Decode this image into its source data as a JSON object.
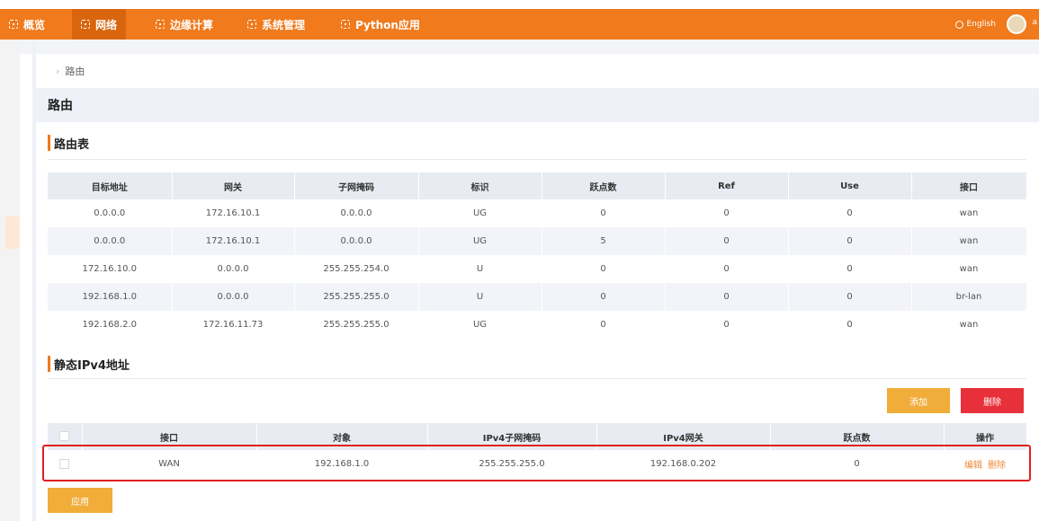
{
  "topnav": {
    "items": [
      {
        "label": "概览"
      },
      {
        "label": "网络"
      },
      {
        "label": "边缘计算"
      },
      {
        "label": "系统管理"
      },
      {
        "label": "Python应用"
      }
    ],
    "active_index": 1,
    "language": "English",
    "user_initial": "a"
  },
  "breadcrumb": {
    "current": "路由"
  },
  "page_title": "路由",
  "route_table": {
    "title": "路由表",
    "columns": [
      "目标地址",
      "网关",
      "子网掩码",
      "标识",
      "跃点数",
      "Ref",
      "Use",
      "接口"
    ],
    "rows": [
      [
        "0.0.0.0",
        "172.16.10.1",
        "0.0.0.0",
        "UG",
        "0",
        "0",
        "0",
        "wan"
      ],
      [
        "0.0.0.0",
        "172.16.10.1",
        "0.0.0.0",
        "UG",
        "5",
        "0",
        "0",
        "wan"
      ],
      [
        "172.16.10.0",
        "0.0.0.0",
        "255.255.254.0",
        "U",
        "0",
        "0",
        "0",
        "wan"
      ],
      [
        "192.168.1.0",
        "0.0.0.0",
        "255.255.255.0",
        "U",
        "0",
        "0",
        "0",
        "br-lan"
      ],
      [
        "192.168.2.0",
        "172.16.11.73",
        "255.255.255.0",
        "UG",
        "0",
        "0",
        "0",
        "wan"
      ]
    ]
  },
  "static_ipv4": {
    "title": "静态IPv4地址",
    "add_label": "添加",
    "delete_label": "删除",
    "columns": [
      "接口",
      "对象",
      "IPv4子网掩码",
      "IPv4网关",
      "跃点数",
      "操作"
    ],
    "rows": [
      {
        "interface": "WAN",
        "object": "192.168.1.0",
        "mask": "255.255.255.0",
        "gateway": "192.168.0.202",
        "metric": "0",
        "edit": "编辑",
        "delete": "删除"
      }
    ],
    "apply_label": "应用"
  }
}
